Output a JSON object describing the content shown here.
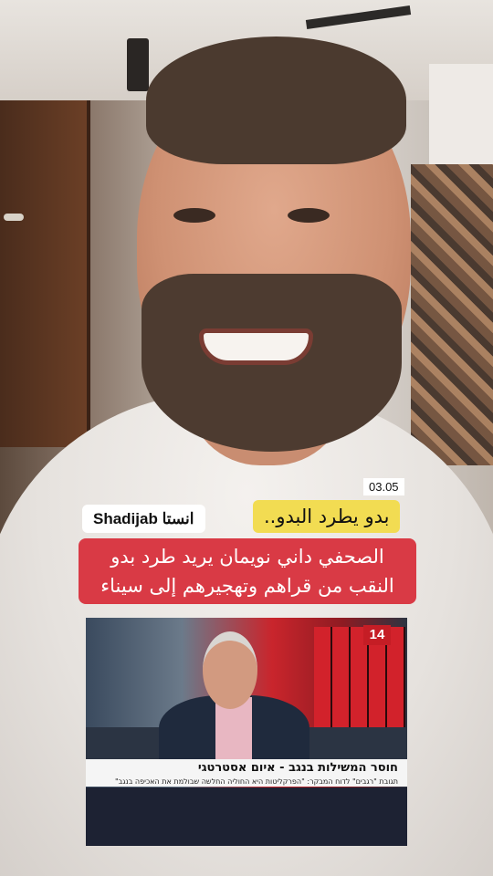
{
  "overlay": {
    "date": "03.05",
    "instagram_tag": "انستا Shadijab",
    "yellow_headline": "بدو يطرد البدو..",
    "red_headline": {
      "line1": "الصحفي داني نويمان يريد طرد بدو",
      "line2": "النقب من قراهم وتهجيرهم إلى سيناء"
    }
  },
  "tv_clip": {
    "channel_logo": "14",
    "headline": "חוסר המשילות בנגב - איום אסטרטגי",
    "subline": "תגובת \"רגבים\" לדוח המבקר: \"הפרקליטות היא החוליה החלשה שבולמת את האכיפה בנגב\""
  }
}
